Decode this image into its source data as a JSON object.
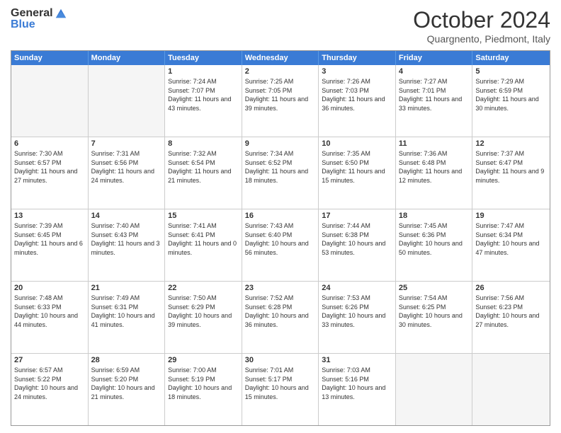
{
  "logo": {
    "general": "General",
    "blue": "Blue"
  },
  "title": "October 2024",
  "subtitle": "Quargnento, Piedmont, Italy",
  "header_days": [
    "Sunday",
    "Monday",
    "Tuesday",
    "Wednesday",
    "Thursday",
    "Friday",
    "Saturday"
  ],
  "weeks": [
    [
      {
        "day": "",
        "sunrise": "",
        "sunset": "",
        "daylight": "",
        "empty": true
      },
      {
        "day": "",
        "sunrise": "",
        "sunset": "",
        "daylight": "",
        "empty": true
      },
      {
        "day": "1",
        "sunrise": "Sunrise: 7:24 AM",
        "sunset": "Sunset: 7:07 PM",
        "daylight": "Daylight: 11 hours and 43 minutes.",
        "empty": false
      },
      {
        "day": "2",
        "sunrise": "Sunrise: 7:25 AM",
        "sunset": "Sunset: 7:05 PM",
        "daylight": "Daylight: 11 hours and 39 minutes.",
        "empty": false
      },
      {
        "day": "3",
        "sunrise": "Sunrise: 7:26 AM",
        "sunset": "Sunset: 7:03 PM",
        "daylight": "Daylight: 11 hours and 36 minutes.",
        "empty": false
      },
      {
        "day": "4",
        "sunrise": "Sunrise: 7:27 AM",
        "sunset": "Sunset: 7:01 PM",
        "daylight": "Daylight: 11 hours and 33 minutes.",
        "empty": false
      },
      {
        "day": "5",
        "sunrise": "Sunrise: 7:29 AM",
        "sunset": "Sunset: 6:59 PM",
        "daylight": "Daylight: 11 hours and 30 minutes.",
        "empty": false
      }
    ],
    [
      {
        "day": "6",
        "sunrise": "Sunrise: 7:30 AM",
        "sunset": "Sunset: 6:57 PM",
        "daylight": "Daylight: 11 hours and 27 minutes.",
        "empty": false
      },
      {
        "day": "7",
        "sunrise": "Sunrise: 7:31 AM",
        "sunset": "Sunset: 6:56 PM",
        "daylight": "Daylight: 11 hours and 24 minutes.",
        "empty": false
      },
      {
        "day": "8",
        "sunrise": "Sunrise: 7:32 AM",
        "sunset": "Sunset: 6:54 PM",
        "daylight": "Daylight: 11 hours and 21 minutes.",
        "empty": false
      },
      {
        "day": "9",
        "sunrise": "Sunrise: 7:34 AM",
        "sunset": "Sunset: 6:52 PM",
        "daylight": "Daylight: 11 hours and 18 minutes.",
        "empty": false
      },
      {
        "day": "10",
        "sunrise": "Sunrise: 7:35 AM",
        "sunset": "Sunset: 6:50 PM",
        "daylight": "Daylight: 11 hours and 15 minutes.",
        "empty": false
      },
      {
        "day": "11",
        "sunrise": "Sunrise: 7:36 AM",
        "sunset": "Sunset: 6:48 PM",
        "daylight": "Daylight: 11 hours and 12 minutes.",
        "empty": false
      },
      {
        "day": "12",
        "sunrise": "Sunrise: 7:37 AM",
        "sunset": "Sunset: 6:47 PM",
        "daylight": "Daylight: 11 hours and 9 minutes.",
        "empty": false
      }
    ],
    [
      {
        "day": "13",
        "sunrise": "Sunrise: 7:39 AM",
        "sunset": "Sunset: 6:45 PM",
        "daylight": "Daylight: 11 hours and 6 minutes.",
        "empty": false
      },
      {
        "day": "14",
        "sunrise": "Sunrise: 7:40 AM",
        "sunset": "Sunset: 6:43 PM",
        "daylight": "Daylight: 11 hours and 3 minutes.",
        "empty": false
      },
      {
        "day": "15",
        "sunrise": "Sunrise: 7:41 AM",
        "sunset": "Sunset: 6:41 PM",
        "daylight": "Daylight: 11 hours and 0 minutes.",
        "empty": false
      },
      {
        "day": "16",
        "sunrise": "Sunrise: 7:43 AM",
        "sunset": "Sunset: 6:40 PM",
        "daylight": "Daylight: 10 hours and 56 minutes.",
        "empty": false
      },
      {
        "day": "17",
        "sunrise": "Sunrise: 7:44 AM",
        "sunset": "Sunset: 6:38 PM",
        "daylight": "Daylight: 10 hours and 53 minutes.",
        "empty": false
      },
      {
        "day": "18",
        "sunrise": "Sunrise: 7:45 AM",
        "sunset": "Sunset: 6:36 PM",
        "daylight": "Daylight: 10 hours and 50 minutes.",
        "empty": false
      },
      {
        "day": "19",
        "sunrise": "Sunrise: 7:47 AM",
        "sunset": "Sunset: 6:34 PM",
        "daylight": "Daylight: 10 hours and 47 minutes.",
        "empty": false
      }
    ],
    [
      {
        "day": "20",
        "sunrise": "Sunrise: 7:48 AM",
        "sunset": "Sunset: 6:33 PM",
        "daylight": "Daylight: 10 hours and 44 minutes.",
        "empty": false
      },
      {
        "day": "21",
        "sunrise": "Sunrise: 7:49 AM",
        "sunset": "Sunset: 6:31 PM",
        "daylight": "Daylight: 10 hours and 41 minutes.",
        "empty": false
      },
      {
        "day": "22",
        "sunrise": "Sunrise: 7:50 AM",
        "sunset": "Sunset: 6:29 PM",
        "daylight": "Daylight: 10 hours and 39 minutes.",
        "empty": false
      },
      {
        "day": "23",
        "sunrise": "Sunrise: 7:52 AM",
        "sunset": "Sunset: 6:28 PM",
        "daylight": "Daylight: 10 hours and 36 minutes.",
        "empty": false
      },
      {
        "day": "24",
        "sunrise": "Sunrise: 7:53 AM",
        "sunset": "Sunset: 6:26 PM",
        "daylight": "Daylight: 10 hours and 33 minutes.",
        "empty": false
      },
      {
        "day": "25",
        "sunrise": "Sunrise: 7:54 AM",
        "sunset": "Sunset: 6:25 PM",
        "daylight": "Daylight: 10 hours and 30 minutes.",
        "empty": false
      },
      {
        "day": "26",
        "sunrise": "Sunrise: 7:56 AM",
        "sunset": "Sunset: 6:23 PM",
        "daylight": "Daylight: 10 hours and 27 minutes.",
        "empty": false
      }
    ],
    [
      {
        "day": "27",
        "sunrise": "Sunrise: 6:57 AM",
        "sunset": "Sunset: 5:22 PM",
        "daylight": "Daylight: 10 hours and 24 minutes.",
        "empty": false
      },
      {
        "day": "28",
        "sunrise": "Sunrise: 6:59 AM",
        "sunset": "Sunset: 5:20 PM",
        "daylight": "Daylight: 10 hours and 21 minutes.",
        "empty": false
      },
      {
        "day": "29",
        "sunrise": "Sunrise: 7:00 AM",
        "sunset": "Sunset: 5:19 PM",
        "daylight": "Daylight: 10 hours and 18 minutes.",
        "empty": false
      },
      {
        "day": "30",
        "sunrise": "Sunrise: 7:01 AM",
        "sunset": "Sunset: 5:17 PM",
        "daylight": "Daylight: 10 hours and 15 minutes.",
        "empty": false
      },
      {
        "day": "31",
        "sunrise": "Sunrise: 7:03 AM",
        "sunset": "Sunset: 5:16 PM",
        "daylight": "Daylight: 10 hours and 13 minutes.",
        "empty": false
      },
      {
        "day": "",
        "sunrise": "",
        "sunset": "",
        "daylight": "",
        "empty": true
      },
      {
        "day": "",
        "sunrise": "",
        "sunset": "",
        "daylight": "",
        "empty": true
      }
    ]
  ]
}
